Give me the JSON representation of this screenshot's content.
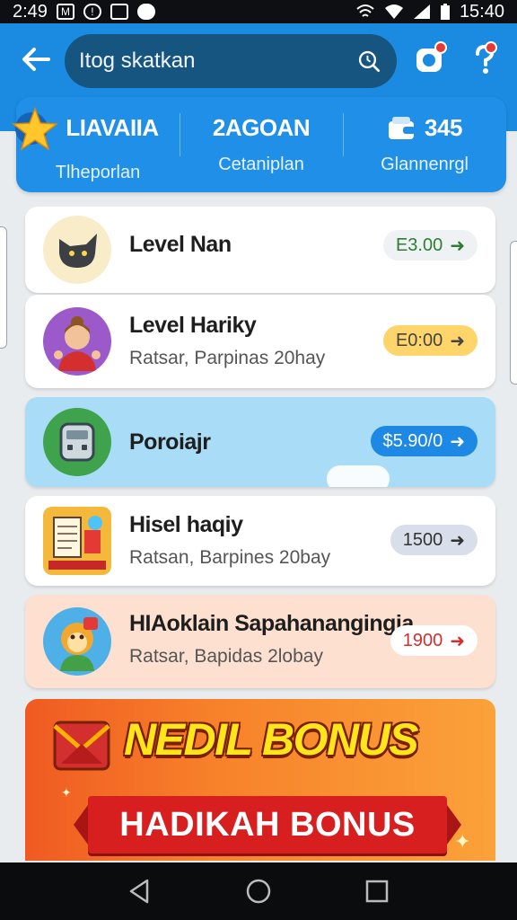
{
  "status_bar": {
    "time_left": "2:49",
    "time_right": "15:40"
  },
  "search": {
    "value": "Itog skatkan"
  },
  "stats": [
    {
      "value": "LIAVAIIA",
      "label": "Tlheporlan"
    },
    {
      "value": "2AGOAN",
      "label": "Cetaniplan"
    },
    {
      "value": "345",
      "label": "Glannenrgl",
      "icon": "wallet-icon"
    }
  ],
  "items": [
    {
      "title": "Level Nan",
      "subtitle": "",
      "price": "E3.00",
      "price_color": "#2e7d32",
      "pill_bg": "#eef2f4",
      "icon": "cat-avatar-icon"
    },
    {
      "title": "Level Hariky",
      "subtitle": "Ratsar, Parpinas 20hay",
      "price": "E0:00",
      "price_color": "#444",
      "pill_bg": "#fdd56a",
      "icon": "person-avatar-icon"
    },
    {
      "title": "Poroiajr",
      "subtitle": "",
      "price": "$5.90/0",
      "price_color": "#ffffff",
      "pill_bg": "#1e88e5",
      "icon": "device-avatar-icon"
    },
    {
      "title": "Hisel haqiy",
      "subtitle": "Ratsan, Barpines 20bay",
      "price": "1500",
      "price_color": "#333",
      "pill_bg": "#d8dfea",
      "icon": "books-avatar-icon"
    },
    {
      "title": "HIAoklain Sapahanangingja",
      "subtitle": "Ratsar, Bapidas 2lobay",
      "price": "1900",
      "price_color": "#d32f2f",
      "pill_bg": "#ffffff",
      "icon": "monkey-avatar-icon"
    }
  ],
  "bonus": {
    "title": "NEDIL BONUS",
    "ribbon": "HADIKAH BONUS"
  },
  "colors": {
    "app_bar": "#1a8be0",
    "stats_card": "#1f8fe8",
    "highlight_row": "#a9ddf7",
    "bonus_row": "#fde0cf"
  }
}
